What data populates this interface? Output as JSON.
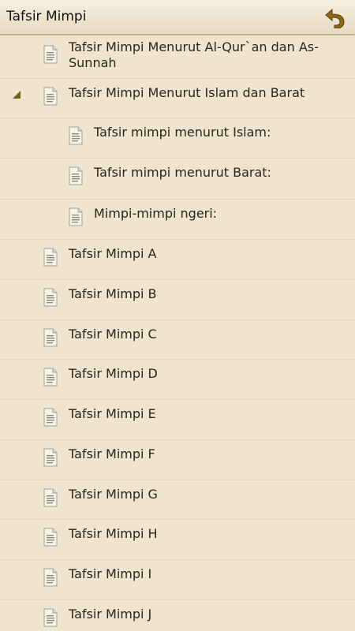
{
  "header": {
    "title": "Tafsir Mimpi",
    "back_icon": "back-arrow-icon"
  },
  "items": [
    {
      "label": "Tafsir Mimpi Menurut Al-Qur`an dan As-Sunnah",
      "icon": "document-icon",
      "level": 0
    },
    {
      "label": "Tafsir Mimpi Menurut Islam dan Barat",
      "icon": "document-icon",
      "level": 0,
      "expanded": true
    },
    {
      "label": "Tafsir mimpi menurut Islam:",
      "icon": "document-icon",
      "level": 1
    },
    {
      "label": "Tafsir mimpi menurut Barat:",
      "icon": "document-icon",
      "level": 1
    },
    {
      "label": "Mimpi-mimpi ngeri:",
      "icon": "document-icon",
      "level": 1
    },
    {
      "label": "Tafsir Mimpi A",
      "icon": "document-icon",
      "level": 0
    },
    {
      "label": "Tafsir Mimpi B",
      "icon": "document-icon",
      "level": 0
    },
    {
      "label": "Tafsir Mimpi C",
      "icon": "document-icon",
      "level": 0
    },
    {
      "label": "Tafsir Mimpi D",
      "icon": "document-icon",
      "level": 0
    },
    {
      "label": "Tafsir Mimpi E",
      "icon": "document-icon",
      "level": 0
    },
    {
      "label": "Tafsir Mimpi F",
      "icon": "document-icon",
      "level": 0
    },
    {
      "label": "Tafsir Mimpi G",
      "icon": "document-icon",
      "level": 0
    },
    {
      "label": "Tafsir Mimpi H",
      "icon": "document-icon",
      "level": 0
    },
    {
      "label": "Tafsir Mimpi I",
      "icon": "document-icon",
      "level": 0
    },
    {
      "label": "Tafsir Mimpi J",
      "icon": "document-icon",
      "level": 0
    }
  ],
  "colors": {
    "background": "#efe5cf",
    "header": "#ece2cc",
    "divider": "#e2d6bd",
    "icon_accent": "#8b6f1d"
  }
}
